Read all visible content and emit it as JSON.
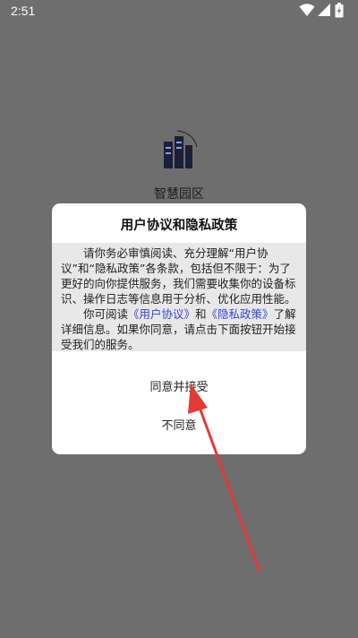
{
  "status_bar": {
    "time": "2:51",
    "icons": [
      "wifi-icon",
      "signal-icon",
      "battery-icon"
    ]
  },
  "splash": {
    "app_name": "智慧园区",
    "logo_icon": "building-logo-icon"
  },
  "dialog": {
    "title": "用户协议和隐私政策",
    "para1": "请你务必审慎阅读、充分理解“用户协议”和“隐私政策”各条款，包括但不限于：为了更好的向你提供服务，我们需要收集你的设备标识、操作日志等信息用于分析、优化应用性能。",
    "para2_prefix": "你可阅读",
    "user_agreement_link": "《用户协议》",
    "para2_and": "和",
    "privacy_policy_link": "《隐私政策》",
    "para2_suffix": "了解详细信息。如果你同意，请点击下面按钮开始接受我们的服务。",
    "accept_label": "同意并接受",
    "decline_label": "不同意"
  },
  "colors": {
    "overlay": "#6e6e6e",
    "link": "#3a43d8",
    "annotation_arrow": "#e53935"
  }
}
